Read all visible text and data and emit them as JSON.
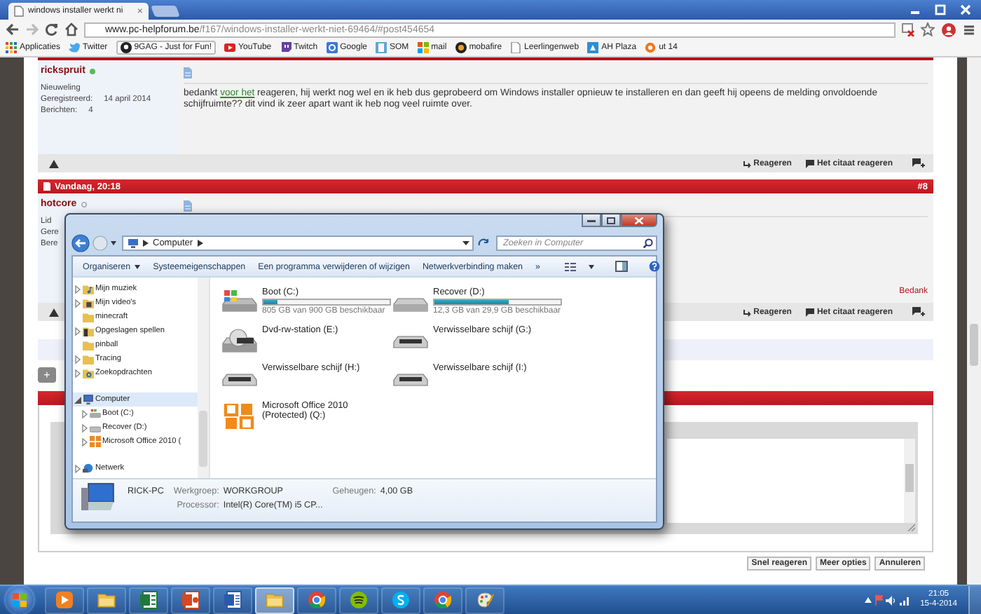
{
  "browser": {
    "tab_title": "windows installer werkt ni",
    "tab_close": "×",
    "url_host": "www.pc-helpforum.be",
    "url_path": "/f167/windows-installer-werkt-niet-69464/#post454654",
    "bookmarks": [
      {
        "label": "Applicaties",
        "kind": "apps"
      },
      {
        "label": "Twitter",
        "kind": "twitter"
      },
      {
        "label": "9GAG - Just for Fun!",
        "kind": "gag"
      },
      {
        "label": "YouTube",
        "kind": "youtube"
      },
      {
        "label": "Twitch",
        "kind": "twitch"
      },
      {
        "label": "Google",
        "kind": "google"
      },
      {
        "label": "SOM",
        "kind": "som"
      },
      {
        "label": "mail",
        "kind": "mail"
      },
      {
        "label": "mobafire",
        "kind": "mobafire"
      },
      {
        "label": "Leerlingenweb",
        "kind": "page"
      },
      {
        "label": "AH Plaza",
        "kind": "ahplaza"
      },
      {
        "label": "ut 14",
        "kind": "ut"
      }
    ]
  },
  "posts": [
    {
      "author": "rickspruit",
      "online": true,
      "rank": "Nieuweling",
      "stats": [
        {
          "label": "Geregistreerd:",
          "value": "14 april 2014"
        },
        {
          "label": "Berichten:",
          "value": "4"
        }
      ],
      "message": {
        "start": "bedankt ",
        "link": "voor het",
        "end": " reageren, hij werkt nog wel en ik heb dus geprobeerd om Windows installer opnieuw te installeren en dan geeft hij opeens de melding onvoldoende schijfruimte?? dit vind ik zeer apart want ik heb nog veel ruimte over."
      },
      "actions": [
        "Reageren",
        "Het citaat reageren"
      ]
    },
    {
      "header": {
        "date": "Vandaag, 20:18",
        "number": "#8"
      },
      "author": "hotcore",
      "online": false,
      "rank": "Lid",
      "stats": [
        {
          "label": "Gere"
        },
        {
          "label": "Bere"
        }
      ],
      "thanks": "Bedank",
      "actions": [
        "Reageren",
        "Het citaat reageren"
      ]
    }
  ],
  "quick_reply": {
    "expand_button": "+",
    "buttons": [
      "Snel reageren",
      "Meer opties",
      "Annuleren"
    ]
  },
  "explorer": {
    "location": "Computer",
    "search": {
      "placeholder": "Zoeken in Computer"
    },
    "toolbar": [
      {
        "label": "Organiseren",
        "dropdown": true
      },
      {
        "label": "Systeemeigenschappen",
        "dropdown": false
      },
      {
        "label": "Een programma verwijderen of wijzigen",
        "dropdown": false
      },
      {
        "label": "Netwerkverbinding maken",
        "dropdown": false
      },
      {
        "label": "»",
        "dropdown": false
      }
    ],
    "navigation": [
      {
        "items": [
          {
            "label": "Mijn muziek",
            "kind": "music",
            "expandable": true,
            "expanded": false,
            "selected": false
          },
          {
            "label": "Mijn video's",
            "kind": "video",
            "expandable": true,
            "expanded": false,
            "selected": false
          },
          {
            "label": "minecraft",
            "kind": "folder",
            "expandable": false,
            "selected": false
          },
          {
            "label": "Opgeslagen spellen",
            "kind": "games",
            "expandable": true,
            "expanded": false,
            "selected": false
          },
          {
            "label": "pinball",
            "kind": "folder",
            "expandable": false,
            "selected": false
          },
          {
            "label": "Tracing",
            "kind": "folder",
            "expandable": true,
            "expanded": false,
            "selected": false
          },
          {
            "label": "Zoekopdrachten",
            "kind": "search",
            "expandable": true,
            "expanded": false,
            "selected": false
          }
        ]
      },
      {
        "items": [
          {
            "label": "Computer",
            "kind": "computer",
            "expandable": true,
            "expanded": true,
            "selected": true,
            "children": [
              {
                "label": "Boot (C:)",
                "kind": "osdrive",
                "expandable": true,
                "expanded": false,
                "selected": false
              },
              {
                "label": "Recover (D:)",
                "kind": "drive",
                "expandable": true,
                "expanded": false,
                "selected": false
              },
              {
                "label": "Microsoft Office 2010 (",
                "kind": "office",
                "expandable": true,
                "expanded": false,
                "selected": false
              }
            ]
          }
        ]
      },
      {
        "items": [
          {
            "label": "Netwerk",
            "kind": "network",
            "expandable": true,
            "expanded": false,
            "selected": false
          }
        ]
      }
    ],
    "drives": [
      {
        "name": "Boot (C:)",
        "kind": "osdrive",
        "level": 0.11,
        "reading": "805 GB van 900 GB beschikbaar"
      },
      {
        "name": "Recover (D:)",
        "kind": "drive",
        "level": 0.59,
        "reading": "12,3 GB van 29,9 GB beschikbaar"
      },
      {
        "name": "Dvd-rw-station (E:)",
        "kind": "dvd"
      },
      {
        "name": "Verwisselbare schijf (G:)",
        "kind": "removable"
      },
      {
        "name": "Verwisselbare schijf (H:)",
        "kind": "removable"
      },
      {
        "name": "Verwisselbare schijf (I:)",
        "kind": "removable"
      },
      {
        "name": "Microsoft Office 2010 (Protected) (Q:)",
        "kind": "office"
      }
    ],
    "details": {
      "name": "RICK-PC",
      "fields": [
        {
          "label": "Werkgroep:",
          "value": "WORKGROUP"
        },
        {
          "label": "Geheugen:",
          "value": "4,00 GB"
        },
        {
          "label": "Processor:",
          "value": "Intel(R) Core(TM) i5 CP..."
        }
      ]
    }
  },
  "taskbar": {
    "apps": [
      {
        "kind": "media",
        "active": false
      },
      {
        "kind": "explorer",
        "active": false
      },
      {
        "kind": "excel",
        "active": false
      },
      {
        "kind": "powerpoint",
        "active": false
      },
      {
        "kind": "word",
        "active": false
      },
      {
        "kind": "explorer",
        "active": true
      },
      {
        "kind": "chrome",
        "active": false
      },
      {
        "kind": "spotify",
        "active": false
      },
      {
        "kind": "skype",
        "active": false
      },
      {
        "kind": "chrome",
        "active": false
      },
      {
        "kind": "paint",
        "active": false
      }
    ],
    "time": "21:05",
    "date": "15-4-2014"
  }
}
